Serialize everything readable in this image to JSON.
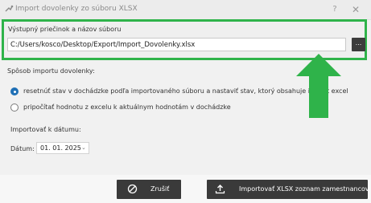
{
  "window": {
    "title": "Import dovolenky zo súboru XLSX",
    "help_label": "?",
    "close_label": "✕"
  },
  "output": {
    "label": "Výstupný priečinok a názov súboru",
    "path_value": "C:/Users/kosco/Desktop/Export/Import_Dovolenky.xlsx",
    "browse_label": "..."
  },
  "import_mode": {
    "label": "Spôsob importu dovolenky:",
    "options": [
      {
        "label": "resetnúť stav v dochádzke podľa importovaného súboru a nastaviť stav, ktorý obsahuje import excel",
        "selected": true
      },
      {
        "label": "pripočítať hodnotu z excelu k aktuálnym hodnotám v dochádzke",
        "selected": false
      }
    ]
  },
  "import_date": {
    "label": "Importovať k dátumu:",
    "date_label": "Dátum:",
    "date_value": "01. 01. 2025"
  },
  "buttons": {
    "cancel_label": "Zrušiť",
    "import_label": "Importovať XLSX zoznam zamestnancov"
  },
  "colors": {
    "highlight": "#2fb34a",
    "radio_selected": "#1f6fb5",
    "button_bg": "#3a3a3a"
  },
  "icons": [
    "app-icon",
    "cancel-icon",
    "upload-icon",
    "chevron-down-icon",
    "arrow-up-annotation"
  ]
}
